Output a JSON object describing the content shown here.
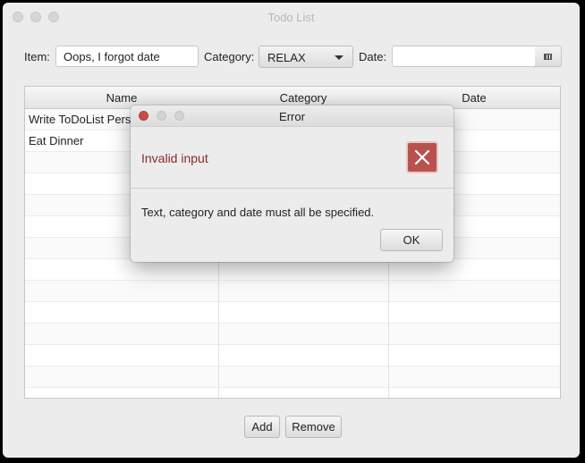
{
  "window": {
    "title": "Todo List"
  },
  "form": {
    "item_label": "Item:",
    "item_value": "Oops, I forgot date",
    "category_label": "Category:",
    "category_value": "RELAX",
    "date_label": "Date:",
    "date_value": ""
  },
  "table": {
    "columns": [
      "Name",
      "Category",
      "Date"
    ],
    "rows": [
      {
        "name": "Write ToDoList Persis",
        "category": "",
        "date": ""
      },
      {
        "name": "Eat Dinner",
        "category": "",
        "date": ""
      }
    ]
  },
  "buttons": {
    "add": "Add",
    "remove": "Remove"
  },
  "dialog": {
    "title": "Error",
    "header": "Invalid input",
    "content": "Text, category and date must all be specified.",
    "ok": "OK"
  },
  "colors": {
    "error_icon": "#b9524f",
    "header_text": "#8b2a2a",
    "close_light": "#c94b46"
  },
  "icons": {
    "date_picker": "calendar-icon",
    "error": "error-x-icon",
    "combo_arrow": "chevron-down-icon"
  }
}
